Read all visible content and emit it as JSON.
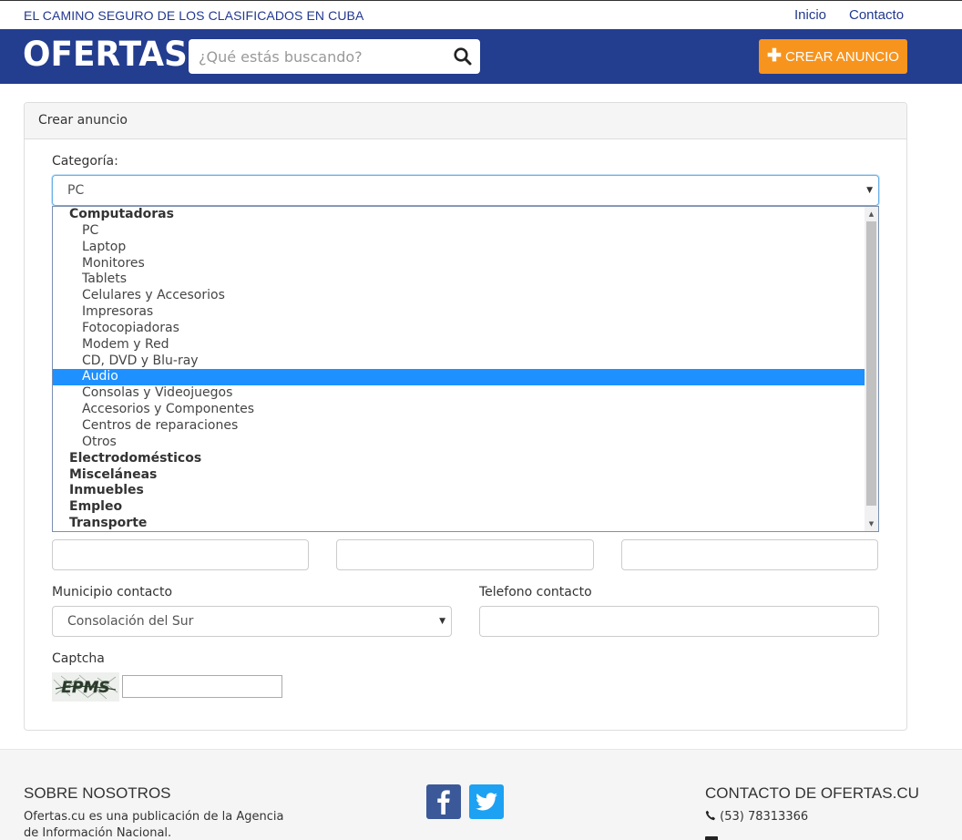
{
  "topbar": {
    "tagline": "EL CAMINO SEGURO DE LOS CLASIFICADOS EN CUBA",
    "nav": [
      "Inicio",
      "Contacto"
    ]
  },
  "header": {
    "logo": "OFERTAS",
    "search_placeholder": "¿Qué estás buscando?",
    "search_icon": "search-icon",
    "crear_label": "CREAR ANUNCIO",
    "crear_icon": "plus-icon",
    "colors": {
      "header_bg": "#233d8f",
      "accent": "#f7941d",
      "selected": "#1e90ff"
    }
  },
  "form": {
    "panel_title": "Crear anuncio",
    "categoria_label": "Categoría:",
    "categoria_value": "PC",
    "dropdown": {
      "groups": [
        {
          "label": "Computadoras",
          "options": [
            "PC",
            "Laptop",
            "Monitores",
            "Tablets",
            "Celulares y Accesorios",
            "Impresoras",
            "Fotocopiadoras",
            "Modem y Red",
            "CD, DVD y Blu-ray",
            "Audio",
            "Consolas y Videojuegos",
            "Accesorios y Componentes",
            "Centros de reparaciones",
            "Otros"
          ]
        },
        {
          "label": "Electrodomésticos",
          "options": []
        },
        {
          "label": "Misceláneas",
          "options": []
        },
        {
          "label": "Inmuebles",
          "options": []
        },
        {
          "label": "Empleo",
          "options": []
        },
        {
          "label": "Transporte",
          "options": []
        }
      ],
      "highlighted": "Audio"
    },
    "municipio_label": "Municipio contacto",
    "municipio_value": "Consolación del Sur",
    "telefono_label": "Telefono contacto",
    "captcha_label": "Captcha",
    "captcha_text": "EPMS"
  },
  "footer": {
    "sobre_title": "SOBRE NOSOTROS",
    "sobre_text_1": "Ofertas.cu es una publicación de la Agencia",
    "sobre_text_2": "de Información Nacional.",
    "contacto_title": "CONTACTO DE OFERTAS.CU",
    "phone": "(53) 78313366",
    "social": [
      "facebook-icon",
      "twitter-icon"
    ]
  }
}
